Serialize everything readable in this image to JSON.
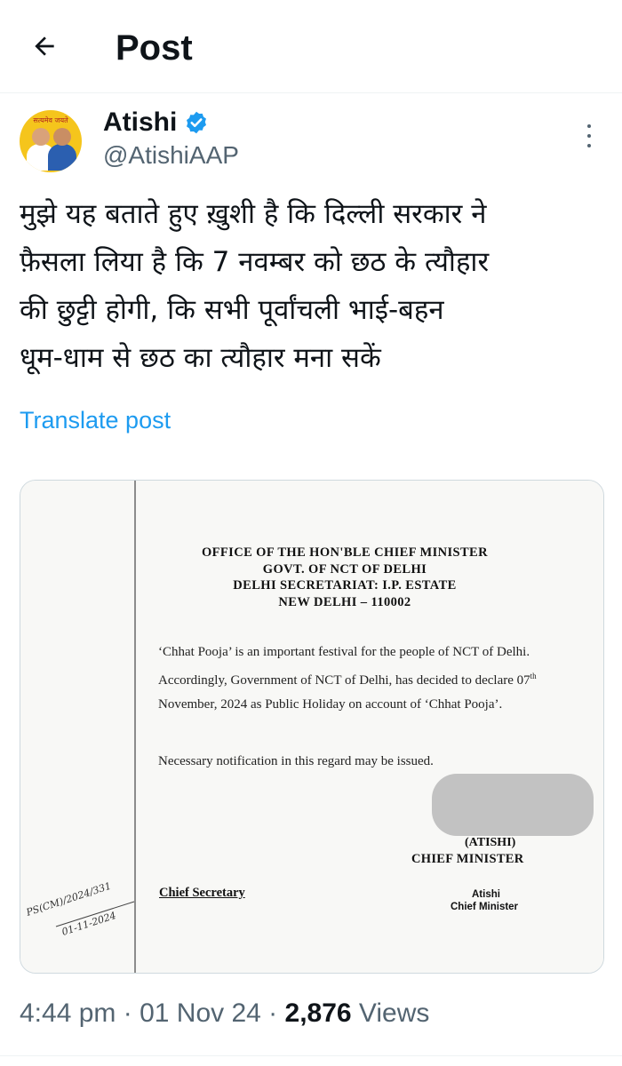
{
  "header": {
    "title": "Post",
    "back_icon": "arrow-left-icon"
  },
  "author": {
    "name": "Atishi",
    "handle": "@AtishiAAP",
    "verified_icon": "verified-badge-icon",
    "verified_color": "#1d9bf0",
    "avatar_text": "सत्यमेव जयते",
    "avatar_bg": "#f5c51c",
    "more_icon": "more-vertical-icon"
  },
  "tweet": {
    "lines": [
      "मुझे यह बताते हुए ख़ुशी है कि दिल्ली सरकार ने",
      "फ़ैसला लिया है कि 7 नवम्बर को छठ के त्यौहार",
      "की छुट्टी होगी, कि सभी पूर्वांचली भाई-बहन",
      "धूम-धाम से छठ का त्यौहार मना सकें"
    ],
    "translate_label": "Translate post",
    "link_color": "#1d9bf0"
  },
  "document": {
    "header_lines": [
      "OFFICE OF THE HON'BLE CHIEF MINISTER",
      "GOVT. OF NCT OF DELHI",
      "DELHI SECRETARIAT: I.P. ESTATE",
      "NEW DELHI – 110002"
    ],
    "body_part1": "‘Chhat Pooja’ is an important festival for the people of NCT of Delhi. Accordingly, Government of NCT of Delhi, has decided to declare 07",
    "body_sup": "th",
    "body_part2": " November, 2024 as Public Holiday on account of ‘Chhat Pooja’.",
    "note": "Necessary notification in this regard may be issued.",
    "signatory_name": "(ATISHI)",
    "signatory_title": "CHIEF MINISTER",
    "chief_secretary": "Chief Secretary",
    "stamp_name": "Atishi",
    "stamp_title": "Chief Minister",
    "handwritten_ref": "PS(CM)/2024/331",
    "handwritten_date": "01-11-2024"
  },
  "meta": {
    "time": "4:44 pm",
    "separator": " · ",
    "date": "01 Nov 24",
    "views_count": "2,876",
    "views_label": " Views"
  }
}
